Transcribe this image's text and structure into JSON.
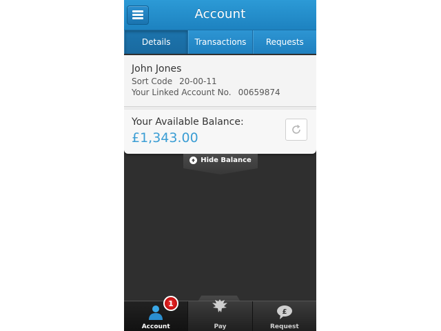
{
  "header": {
    "title": "Account"
  },
  "tabs": [
    {
      "label": "Details",
      "active": true
    },
    {
      "label": "Transactions",
      "active": false
    },
    {
      "label": "Requests",
      "active": false
    }
  ],
  "details": {
    "name": "John Jones",
    "sort_code_label": "Sort Code",
    "sort_code": "20-00-11",
    "linked_account_label": "Your Linked Account No.",
    "linked_account": "00659874"
  },
  "balance": {
    "label": "Your Available Balance:",
    "amount": "£1,343.00"
  },
  "hide_balance": {
    "label": "Hide Balance"
  },
  "bottom_nav": {
    "items": [
      {
        "label": "Account",
        "icon": "account-icon",
        "active": true,
        "badge": "1"
      },
      {
        "label": "Pay",
        "icon": "eagle-icon",
        "active": false
      },
      {
        "label": "Request",
        "icon": "pound-speech-icon",
        "active": false
      }
    ]
  },
  "colors": {
    "header_blue": "#1d82c0",
    "balance_blue": "#3a9dd4",
    "badge_red": "#cc1111"
  }
}
